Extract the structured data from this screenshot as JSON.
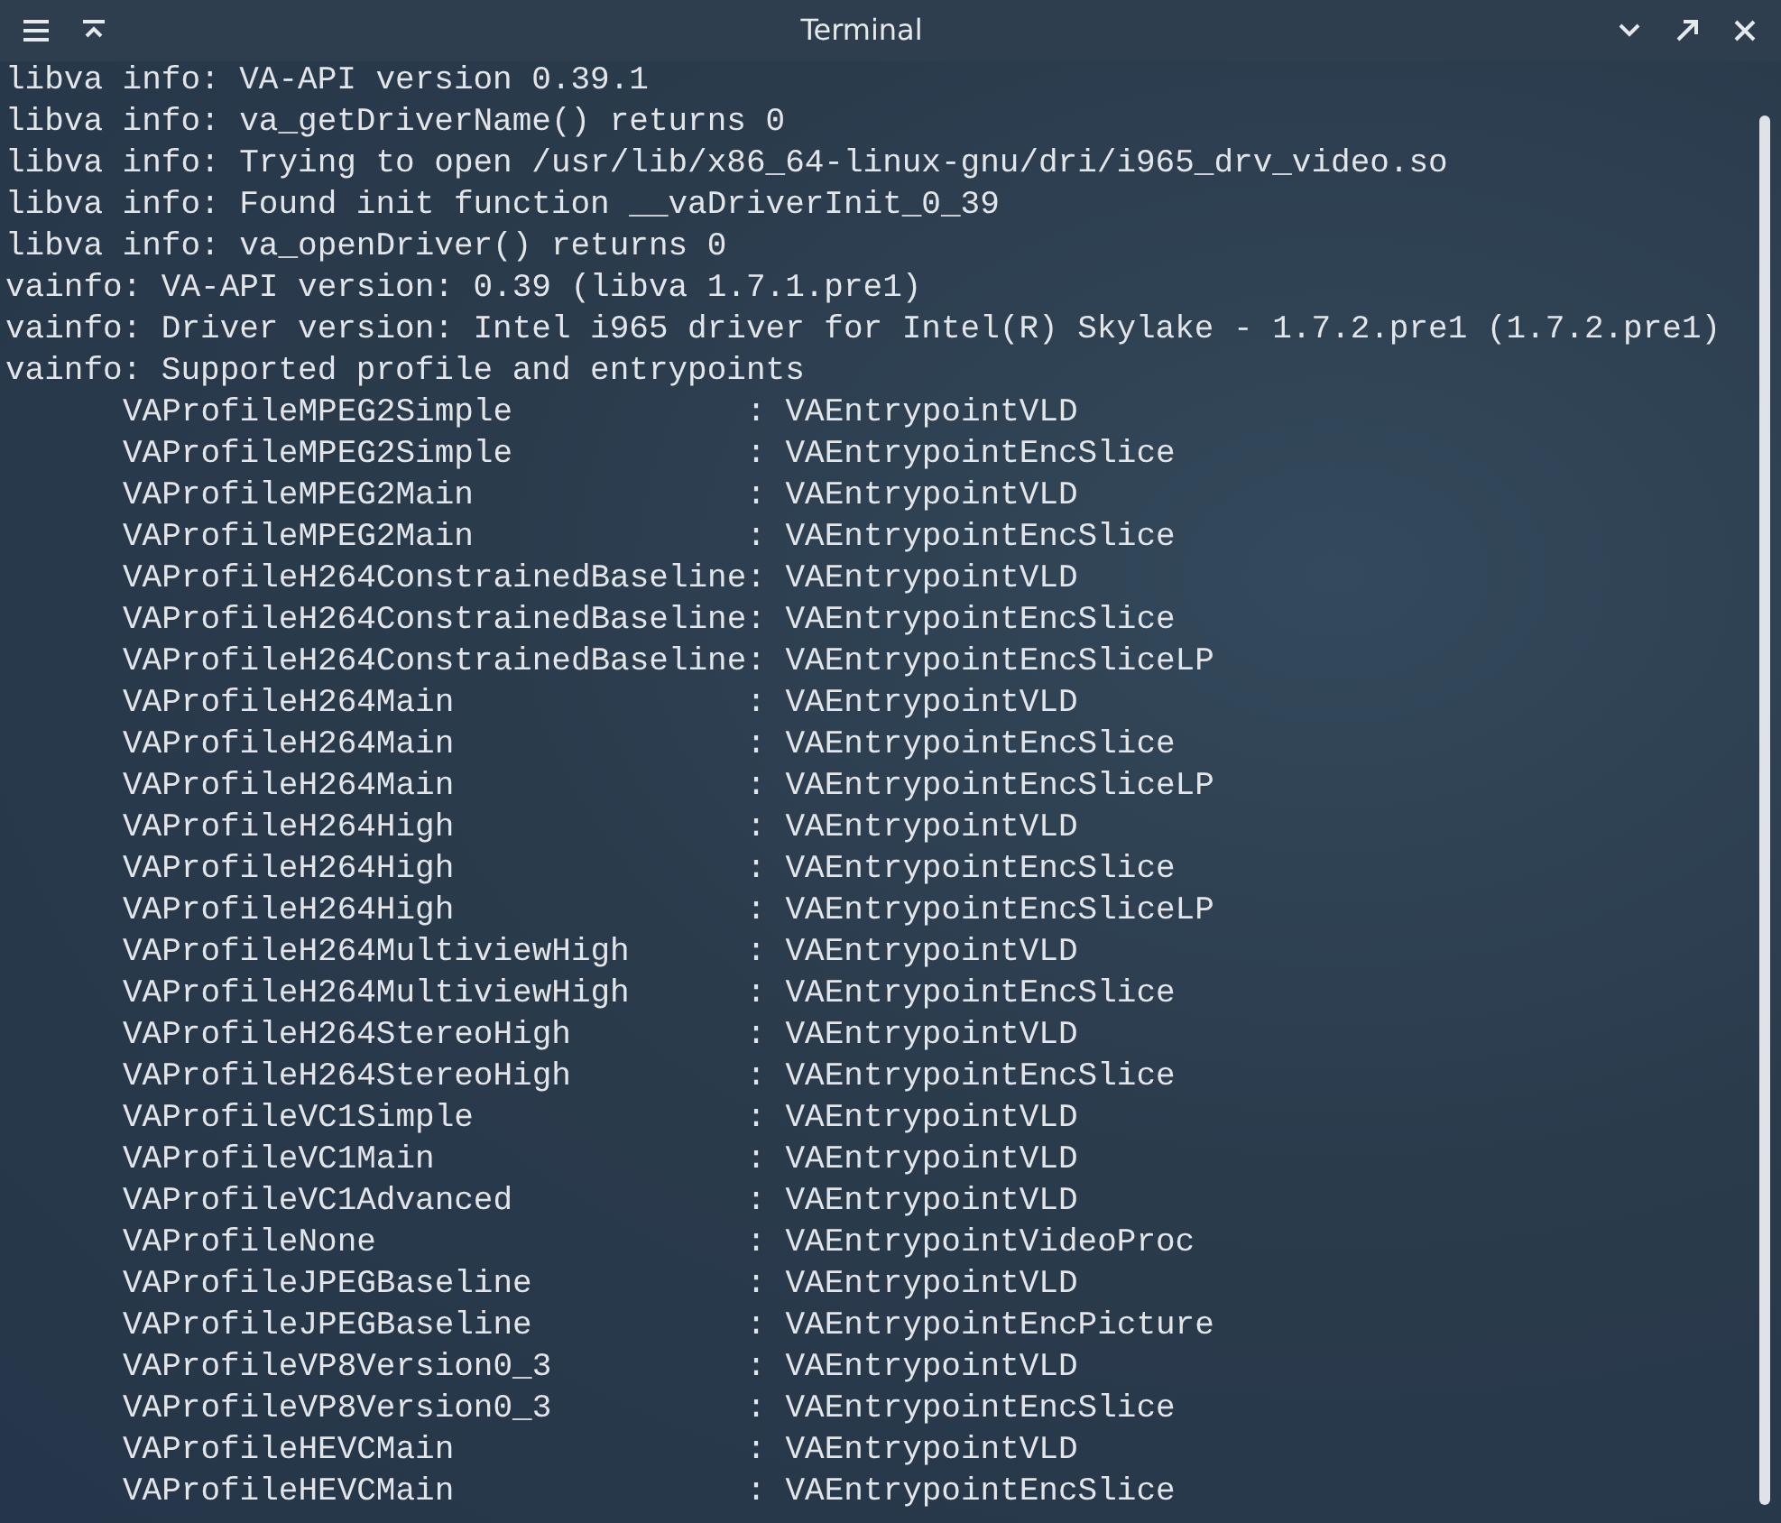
{
  "window": {
    "title": "Terminal"
  },
  "lines": [
    {
      "kind": "header",
      "text": "libva info: VA-API version 0.39.1"
    },
    {
      "kind": "header",
      "text": "libva info: va_getDriverName() returns 0"
    },
    {
      "kind": "header",
      "text": "libva info: Trying to open /usr/lib/x86_64-linux-gnu/dri/i965_drv_video.so"
    },
    {
      "kind": "header",
      "text": "libva info: Found init function __vaDriverInit_0_39"
    },
    {
      "kind": "header",
      "text": "libva info: va_openDriver() returns 0"
    },
    {
      "kind": "header",
      "text": "vainfo: VA-API version: 0.39 (libva 1.7.1.pre1)"
    },
    {
      "kind": "header",
      "text": "vainfo: Driver version: Intel i965 driver for Intel(R) Skylake - 1.7.2.pre1 (1.7.2.pre1)"
    },
    {
      "kind": "header",
      "text": "vainfo: Supported profile and entrypoints"
    },
    {
      "kind": "profile",
      "text": "VAProfileMPEG2Simple            : VAEntrypointVLD"
    },
    {
      "kind": "profile",
      "text": "VAProfileMPEG2Simple            : VAEntrypointEncSlice"
    },
    {
      "kind": "profile",
      "text": "VAProfileMPEG2Main              : VAEntrypointVLD"
    },
    {
      "kind": "profile",
      "text": "VAProfileMPEG2Main              : VAEntrypointEncSlice"
    },
    {
      "kind": "profile",
      "text": "VAProfileH264ConstrainedBaseline: VAEntrypointVLD"
    },
    {
      "kind": "profile",
      "text": "VAProfileH264ConstrainedBaseline: VAEntrypointEncSlice"
    },
    {
      "kind": "profile",
      "text": "VAProfileH264ConstrainedBaseline: VAEntrypointEncSliceLP"
    },
    {
      "kind": "profile",
      "text": "VAProfileH264Main               : VAEntrypointVLD"
    },
    {
      "kind": "profile",
      "text": "VAProfileH264Main               : VAEntrypointEncSlice"
    },
    {
      "kind": "profile",
      "text": "VAProfileH264Main               : VAEntrypointEncSliceLP"
    },
    {
      "kind": "profile",
      "text": "VAProfileH264High               : VAEntrypointVLD"
    },
    {
      "kind": "profile",
      "text": "VAProfileH264High               : VAEntrypointEncSlice"
    },
    {
      "kind": "profile",
      "text": "VAProfileH264High               : VAEntrypointEncSliceLP"
    },
    {
      "kind": "profile",
      "text": "VAProfileH264MultiviewHigh      : VAEntrypointVLD"
    },
    {
      "kind": "profile",
      "text": "VAProfileH264MultiviewHigh      : VAEntrypointEncSlice"
    },
    {
      "kind": "profile",
      "text": "VAProfileH264StereoHigh         : VAEntrypointVLD"
    },
    {
      "kind": "profile",
      "text": "VAProfileH264StereoHigh         : VAEntrypointEncSlice"
    },
    {
      "kind": "profile",
      "text": "VAProfileVC1Simple              : VAEntrypointVLD"
    },
    {
      "kind": "profile",
      "text": "VAProfileVC1Main                : VAEntrypointVLD"
    },
    {
      "kind": "profile",
      "text": "VAProfileVC1Advanced            : VAEntrypointVLD"
    },
    {
      "kind": "profile",
      "text": "VAProfileNone                   : VAEntrypointVideoProc"
    },
    {
      "kind": "profile",
      "text": "VAProfileJPEGBaseline           : VAEntrypointVLD"
    },
    {
      "kind": "profile",
      "text": "VAProfileJPEGBaseline           : VAEntrypointEncPicture"
    },
    {
      "kind": "profile",
      "text": "VAProfileVP8Version0_3          : VAEntrypointVLD"
    },
    {
      "kind": "profile",
      "text": "VAProfileVP8Version0_3          : VAEntrypointEncSlice"
    },
    {
      "kind": "profile",
      "text": "VAProfileHEVCMain               : VAEntrypointVLD"
    },
    {
      "kind": "profile",
      "text": "VAProfileHEVCMain               : VAEntrypointEncSlice"
    }
  ]
}
